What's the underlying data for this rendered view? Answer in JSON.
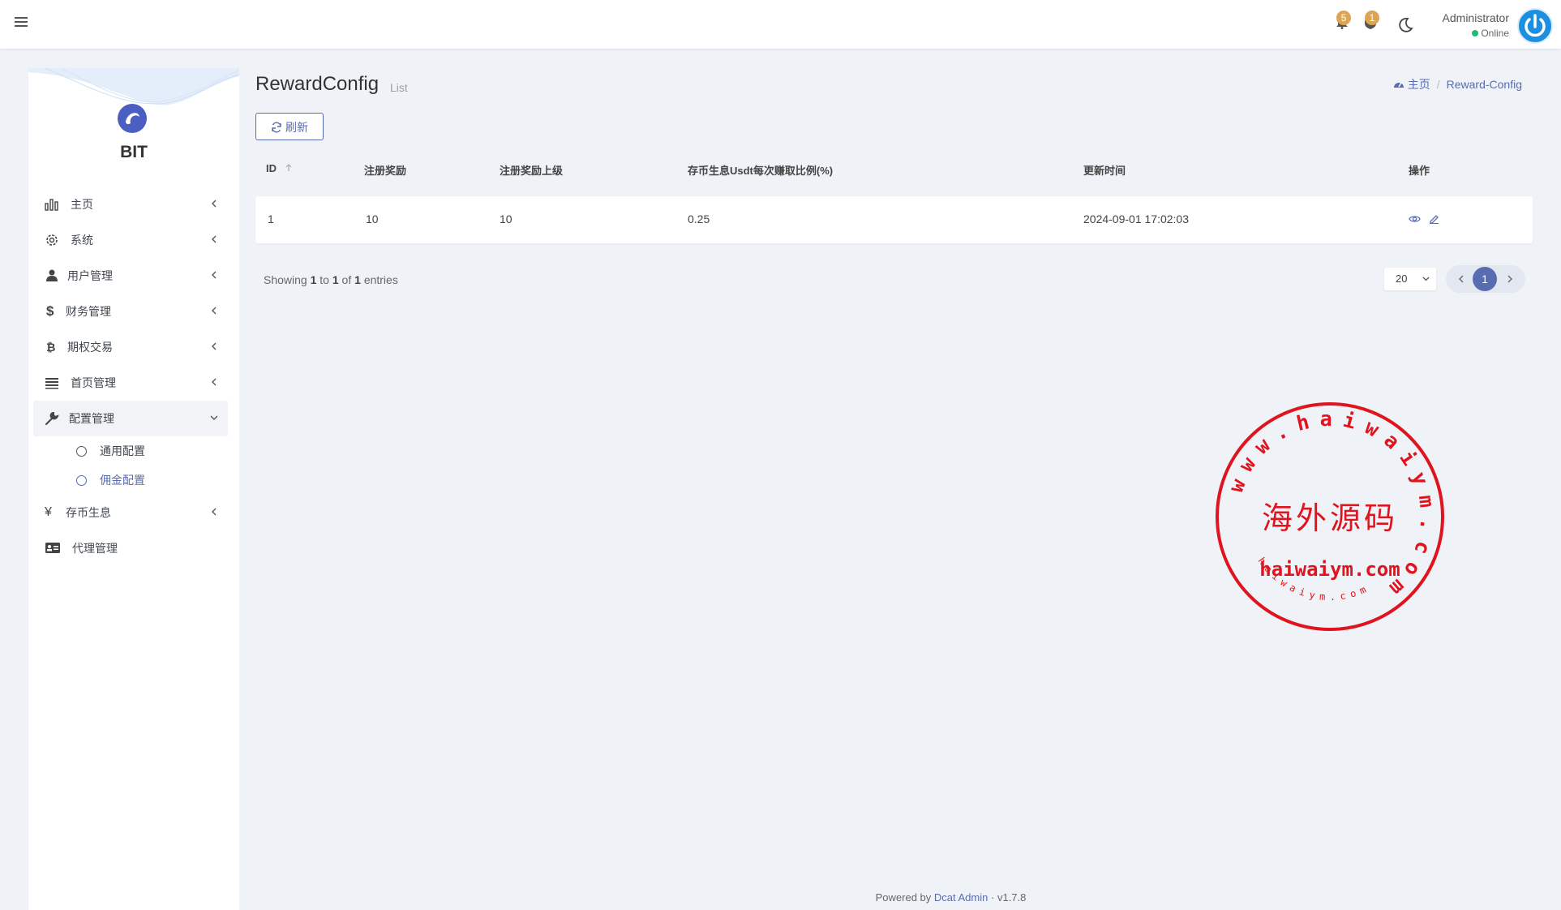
{
  "navbar": {
    "notifications_count": "5",
    "messages_count": "1",
    "user_name": "Administrator",
    "user_status": "Online"
  },
  "sidebar": {
    "brand": "BIT",
    "items": [
      {
        "label": "主页",
        "icon": "bar-chart-icon"
      },
      {
        "label": "系统",
        "icon": "gear-icon"
      },
      {
        "label": "用户管理",
        "icon": "users-icon"
      },
      {
        "label": "财务管理",
        "icon": "dollar-icon"
      },
      {
        "label": "期权交易",
        "icon": "bitcoin-icon"
      },
      {
        "label": "首页管理",
        "icon": "list-icon"
      },
      {
        "label": "配置管理",
        "icon": "wrench-icon"
      },
      {
        "label": "存币生息",
        "icon": "yen-icon"
      },
      {
        "label": "代理管理",
        "icon": "id-card-icon"
      }
    ],
    "subitems": [
      {
        "label": "通用配置"
      },
      {
        "label": "佣金配置"
      }
    ]
  },
  "header": {
    "title": "RewardConfig",
    "subtitle": "List",
    "breadcrumb_home": "主页",
    "breadcrumb_current": "Reward-Config"
  },
  "toolbar": {
    "refresh_label": "刷新"
  },
  "table": {
    "columns": [
      "ID",
      "注册奖励",
      "注册奖励上级",
      "存币生息Usdt每次赚取比例(%)",
      "更新时间",
      "操作"
    ],
    "rows": [
      {
        "id": "1",
        "reward": "10",
        "parent_reward": "10",
        "ratio": "0.25",
        "updated": "2024-09-01 17:02:03"
      }
    ]
  },
  "pagination": {
    "showing_prefix": "Showing",
    "from": "1",
    "to_word": "to",
    "to": "1",
    "of_word": "of",
    "total": "1",
    "entries_word": "entries",
    "per_page": "20",
    "current_page": "1"
  },
  "watermark": {
    "ring_text": "www.haiwaiym.com",
    "center_text": "海外源码",
    "domain_text": "haiwaiym.com",
    "bottom_text": "haiwaiym.com"
  },
  "footer": {
    "powered_by": "Powered by",
    "link": "Dcat Admin",
    "separator": "·",
    "version": "v1.7.8"
  },
  "colors": {
    "accent": "#586cb1",
    "badge": "#dda452",
    "online": "#21b978",
    "stamp": "#e0141e"
  }
}
